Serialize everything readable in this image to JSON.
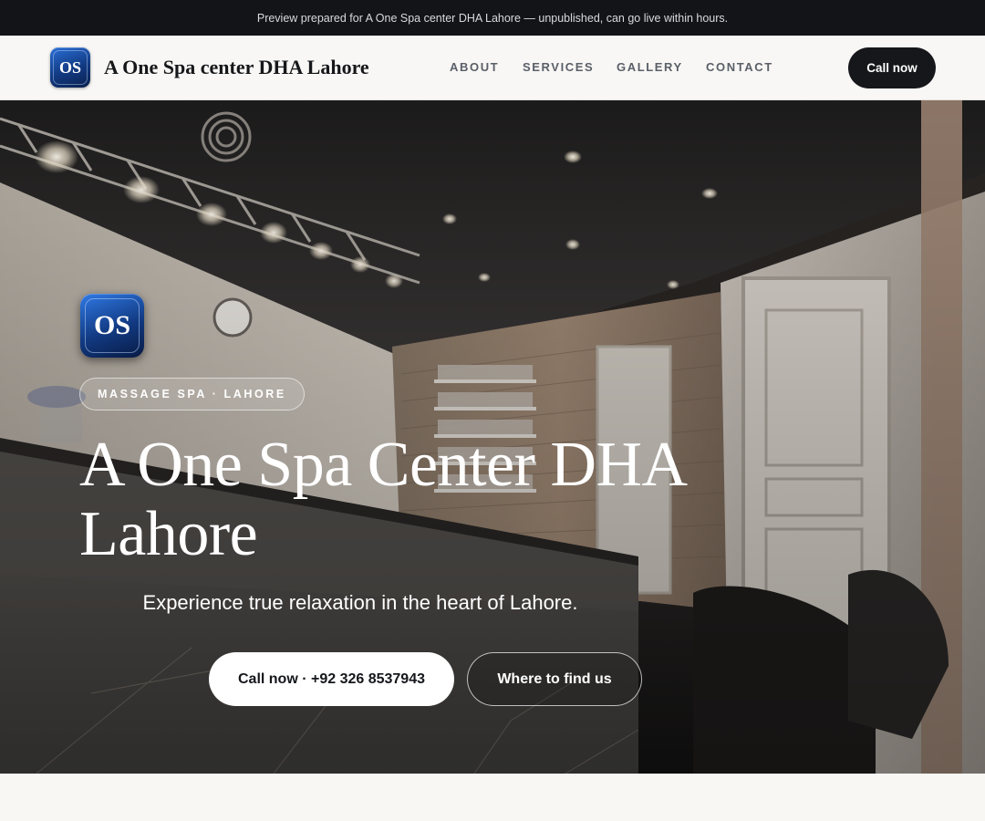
{
  "preview_banner": "Preview prepared for A One Spa center DHA Lahore — unpublished, can go live within hours.",
  "header": {
    "logo_initials": "OS",
    "brand_name": "A One Spa center DHA Lahore",
    "nav": [
      "ABOUT",
      "SERVICES",
      "GALLERY",
      "CONTACT"
    ],
    "cta_label": "Call now"
  },
  "hero": {
    "logo_initials": "OS",
    "eyebrow": "MASSAGE SPA · LAHORE",
    "title": "A One Spa Center DHA Lahore",
    "subtitle": "Experience true relaxation in the heart of Lahore.",
    "primary_button": "Call now · +92 326 8537943",
    "secondary_button": "Where to find us"
  },
  "colors": {
    "dark": "#15171b",
    "logo_blue": "#123a82",
    "page_bg": "#f8f7f4"
  },
  "icons": {
    "logo": "os-monogram-icon"
  }
}
